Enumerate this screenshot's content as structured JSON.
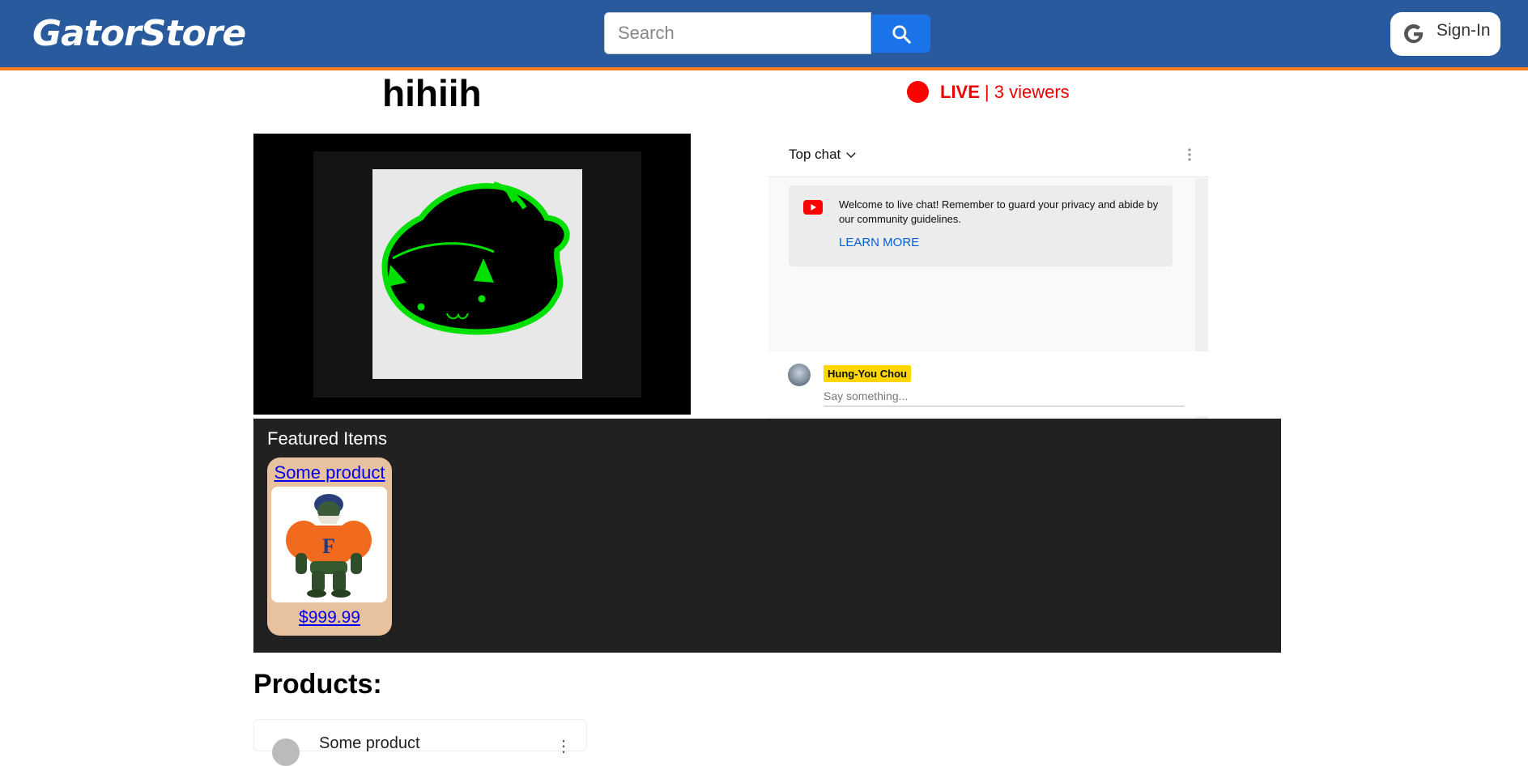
{
  "header": {
    "logo": "GatorStore",
    "search_placeholder": "Search",
    "signin_label": "Sign-In"
  },
  "stream": {
    "title": "hihiih",
    "live_label": "LIVE",
    "viewers_text": "| 3 viewers"
  },
  "chat": {
    "mode_label": "Top chat",
    "welcome_message": "Welcome to live chat! Remember to guard your privacy and abide by our community guidelines.",
    "learn_more": "LEARN MORE",
    "user_name": "Hung-You Chou",
    "input_placeholder": "Say something..."
  },
  "featured": {
    "title": "Featured Items",
    "items": [
      {
        "name": "Some product",
        "price": "$999.99"
      }
    ]
  },
  "products": {
    "heading": "Products:",
    "items": [
      {
        "name": "Some product"
      }
    ]
  },
  "colors": {
    "header_bg": "#2a5a9e",
    "header_accent": "#f47b20",
    "search_button": "#1a73e8",
    "live_red": "#ff0000",
    "featured_bg": "#212121",
    "card_bg": "#e8c29e",
    "chip_yellow": "#ffd600"
  },
  "icons": {
    "search": "search-icon",
    "google": "google-g-icon",
    "live": "live-dot-icon",
    "chevron": "chevron-down-icon",
    "more": "more-vertical-icon",
    "youtube": "youtube-icon"
  }
}
